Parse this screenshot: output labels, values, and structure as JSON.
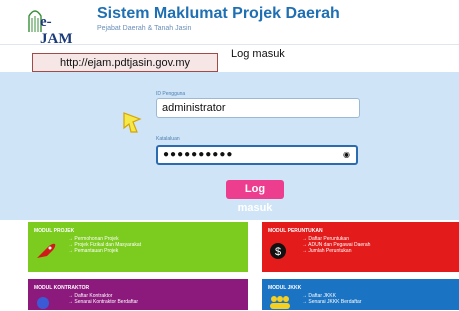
{
  "header": {
    "logo_text": "e-JAM",
    "title": "Sistem Maklumat Projek Daerah",
    "subtitle": "Pejabat Daerah & Tanah Jasin"
  },
  "nav": {
    "login_tab": "Log masuk"
  },
  "url_overlay": "http://ejam.pdtjasin.gov.my",
  "login": {
    "username_label": "ID Pengguna",
    "username_value": "administrator",
    "password_label": "Katalaluan",
    "password_value": "●●●●●●●●●●",
    "submit_label": "Log masuk"
  },
  "modules": [
    {
      "title": "MODUL PROJEK",
      "items": [
        "Permohonan Projek",
        "Projek Fizikal dan Masyarakat",
        "Pemantauan Projek"
      ],
      "color": "#7ccb1f"
    },
    {
      "title": "MODUL PERUNTUKAN",
      "items": [
        "Daftar Peruntukan",
        "ADUN dan Pegawai Daerah",
        "Jumlah Peruntukan"
      ],
      "color": "#e41b1b"
    },
    {
      "title": "MODUL KONTRAKTOR",
      "items": [
        "Daftar Kontraktor",
        "Senarai Kontraktor Berdaftar"
      ],
      "color": "#8c1a7d"
    },
    {
      "title": "MODUL JKKK",
      "items": [
        "Daftar JKKK",
        "Senarai JKKK Berdaftar"
      ],
      "color": "#1b73c4"
    }
  ]
}
